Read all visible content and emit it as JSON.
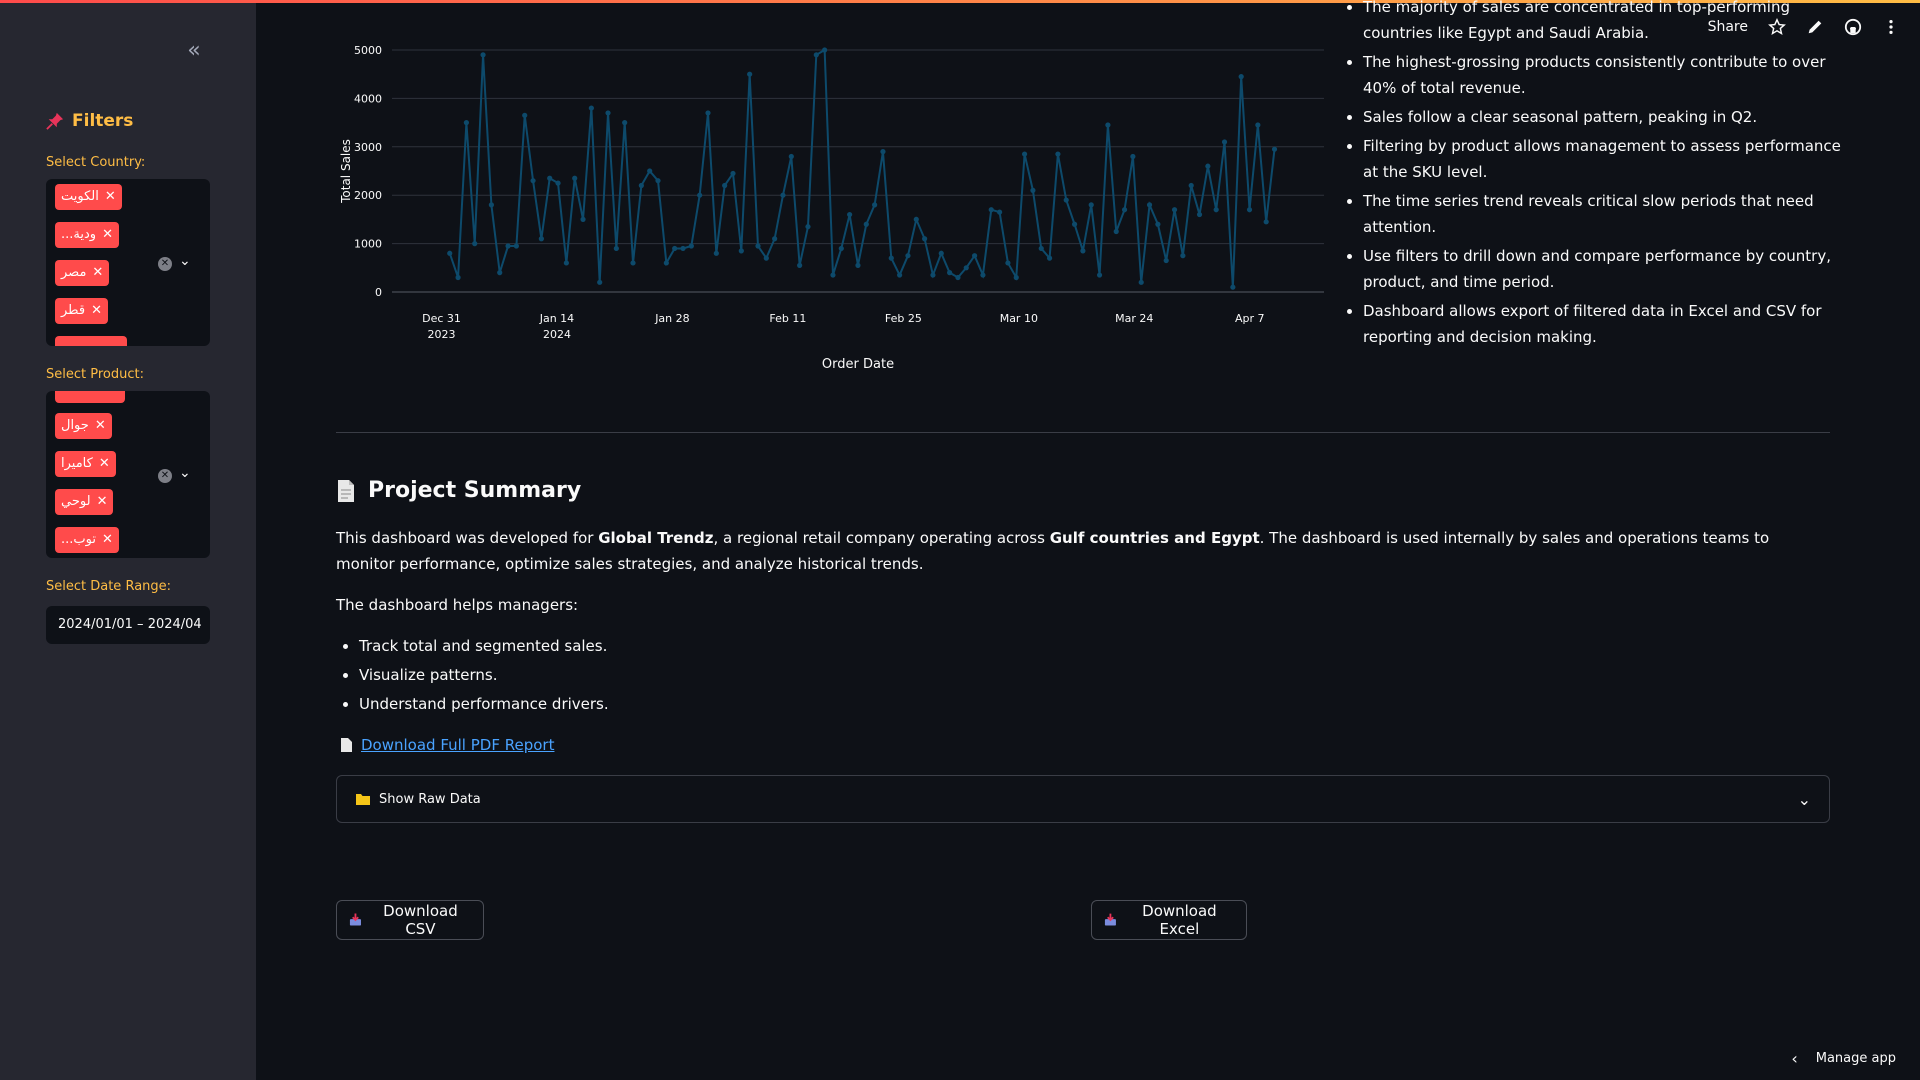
{
  "sidebar": {
    "filters_title": "Filters",
    "country_label": "Select Country:",
    "countries": [
      "الكويت",
      "...ودية",
      "مصر",
      "قطر"
    ],
    "product_label": "Select Product:",
    "products": [
      "جوال",
      "كاميرا",
      "لوحي",
      "...توب"
    ],
    "date_label": "Select Date Range:",
    "date_value": "2024/01/01 – 2024/04"
  },
  "toolbar": {
    "share": "Share"
  },
  "chart_data": {
    "type": "line",
    "xlabel": "Order Date",
    "ylabel": "Total Sales",
    "ylim": [
      0,
      5000
    ],
    "yticks": [
      0,
      1000,
      2000,
      3000,
      4000,
      5000
    ],
    "xticks": [
      {
        "date": "2023-12-31",
        "label": "Dec 31",
        "sub": "2023"
      },
      {
        "date": "2024-01-14",
        "label": "Jan 14",
        "sub": "2024"
      },
      {
        "date": "2024-01-28",
        "label": "Jan 28",
        "sub": ""
      },
      {
        "date": "2024-02-11",
        "label": "Feb 11",
        "sub": ""
      },
      {
        "date": "2024-02-25",
        "label": "Feb 25",
        "sub": ""
      },
      {
        "date": "2024-03-10",
        "label": "Mar 10",
        "sub": ""
      },
      {
        "date": "2024-03-24",
        "label": "Mar 24",
        "sub": ""
      },
      {
        "date": "2024-04-07",
        "label": "Apr 7",
        "sub": ""
      }
    ],
    "xrange": [
      "2023-12-25",
      "2024-04-16"
    ],
    "color": "#0d4a6b",
    "values": [
      800,
      300,
      3500,
      1000,
      4900,
      1800,
      400,
      950,
      950,
      3650,
      2300,
      1100,
      2350,
      2250,
      600,
      2350,
      1500,
      3800,
      200,
      3700,
      900,
      3500,
      600,
      2200,
      2500,
      2300,
      600,
      900,
      900,
      950,
      2000,
      3700,
      800,
      2200,
      2450,
      850,
      4500,
      950,
      700,
      1100,
      2000,
      2800,
      550,
      1350,
      4900,
      5000,
      350,
      900,
      1600,
      550,
      1400,
      1800,
      2900,
      700,
      350,
      750,
      1500,
      1100,
      350,
      800,
      400,
      300,
      500,
      750,
      350,
      1700,
      1650,
      600,
      300,
      2850,
      2100,
      900,
      700,
      2850,
      1900,
      1400,
      850,
      1800,
      350,
      3450,
      1250,
      1700,
      2800,
      200,
      1800,
      1400,
      650,
      1700,
      750,
      2200,
      1600,
      2600,
      1700,
      3100,
      100,
      4450,
      1700,
      3450,
      1450,
      2950
    ]
  },
  "insights": [
    "The majority of sales are concentrated in top-performing countries like Egypt and Saudi Arabia.",
    "The highest-grossing products consistently contribute to over 40% of total revenue.",
    "Sales follow a clear seasonal pattern, peaking in Q2.",
    "Filtering by product allows management to assess performance at the SKU level.",
    "The time series trend reveals critical slow periods that need attention.",
    "Use filters to drill down and compare performance by country, product, and time period.",
    "Dashboard allows export of filtered data in Excel and CSV for reporting and decision making."
  ],
  "summary": {
    "title": "Project Summary",
    "p1_a": "This dashboard was developed for ",
    "p1_b": "Global Trendz",
    "p1_c": ", a regional retail company operating across ",
    "p1_d": "Gulf countries and Egypt",
    "p1_e": ". The dashboard is used internally by sales and operations teams to monitor performance, optimize sales strategies, and analyze historical trends.",
    "p2": "The dashboard helps managers:",
    "bullets": [
      "Track total and segmented sales.",
      "Visualize patterns.",
      "Understand performance drivers."
    ],
    "pdf_link": "Download Full PDF Report"
  },
  "expander": {
    "label": "Show Raw Data"
  },
  "buttons": {
    "csv": "Download CSV",
    "excel": "Download Excel"
  },
  "footer": {
    "manage": "Manage app"
  }
}
